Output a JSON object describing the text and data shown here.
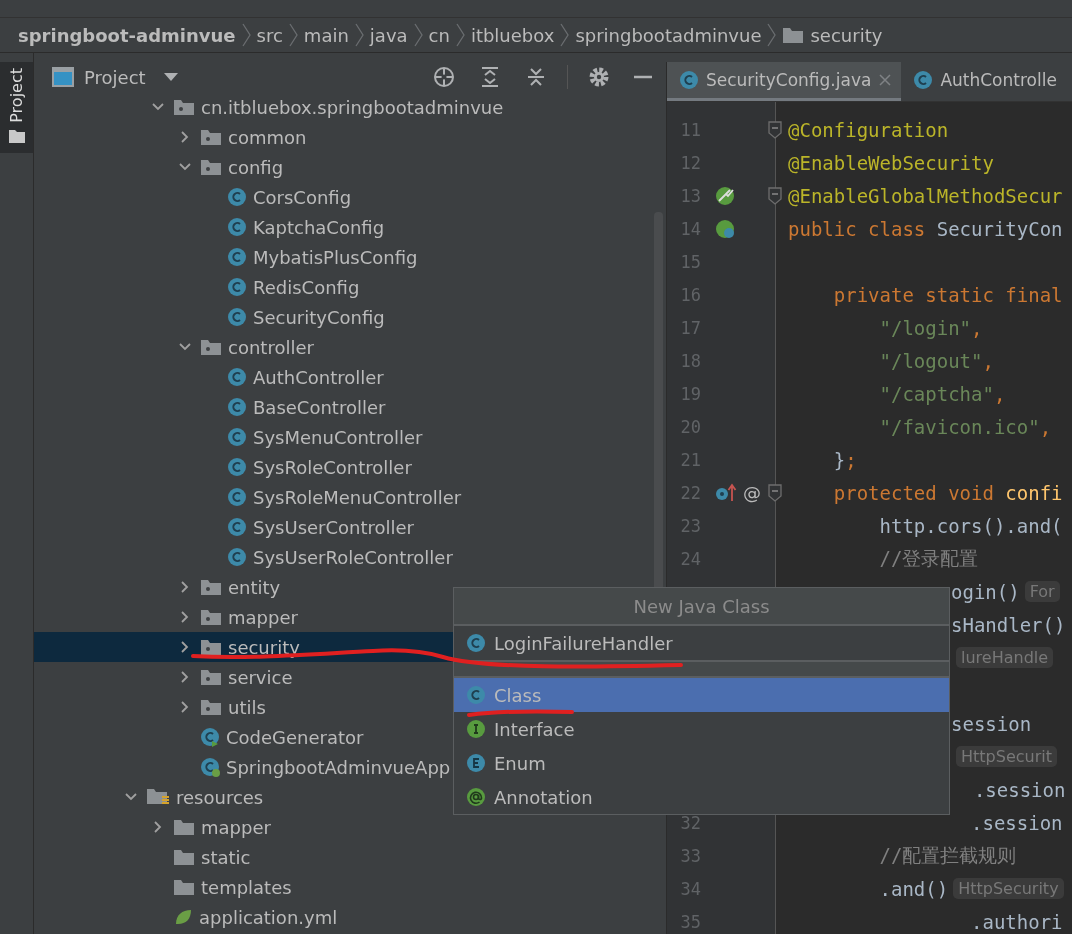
{
  "breadcrumb": [
    {
      "label": "springboot-adminvue",
      "kind": "project"
    },
    {
      "label": "src",
      "kind": "plain"
    },
    {
      "label": "main",
      "kind": "plain"
    },
    {
      "label": "java",
      "kind": "plain"
    },
    {
      "label": "cn",
      "kind": "plain"
    },
    {
      "label": "itbluebox",
      "kind": "plain"
    },
    {
      "label": "springbootadminvue",
      "kind": "plain"
    },
    {
      "label": "security",
      "kind": "folder"
    }
  ],
  "tool_strip": {
    "label": "Project",
    "selected": true
  },
  "project_panel": {
    "title": "Project",
    "tree": [
      {
        "kind": "hidden-parent",
        "children": [
          {
            "label": "cn.itbluebox.springbootadminvue",
            "kind": "package",
            "expanded": true,
            "selected": false,
            "children": [
              {
                "label": "common",
                "kind": "package",
                "expanded": false,
                "selected": false
              },
              {
                "label": "config",
                "kind": "package",
                "expanded": true,
                "selected": false,
                "children": [
                  {
                    "label": "CorsConfig",
                    "kind": "class",
                    "selected": false
                  },
                  {
                    "label": "KaptchaConfig",
                    "kind": "class",
                    "selected": false
                  },
                  {
                    "label": "MybatisPlusConfig",
                    "kind": "class",
                    "selected": false
                  },
                  {
                    "label": "RedisConfig",
                    "kind": "class",
                    "selected": false
                  },
                  {
                    "label": "SecurityConfig",
                    "kind": "class",
                    "selected": false
                  }
                ]
              },
              {
                "label": "controller",
                "kind": "package",
                "expanded": true,
                "selected": false,
                "children": [
                  {
                    "label": "AuthController",
                    "kind": "class",
                    "selected": false
                  },
                  {
                    "label": "BaseController",
                    "kind": "class",
                    "selected": false
                  },
                  {
                    "label": "SysMenuController",
                    "kind": "class",
                    "selected": false
                  },
                  {
                    "label": "SysRoleController",
                    "kind": "class",
                    "selected": false
                  },
                  {
                    "label": "SysRoleMenuController",
                    "kind": "class",
                    "selected": false
                  },
                  {
                    "label": "SysUserController",
                    "kind": "class",
                    "selected": false
                  },
                  {
                    "label": "SysUserRoleController",
                    "kind": "class",
                    "selected": false
                  }
                ]
              },
              {
                "label": "entity",
                "kind": "package",
                "expanded": false,
                "selected": false
              },
              {
                "label": "mapper",
                "kind": "package",
                "expanded": false,
                "selected": false
              },
              {
                "label": "security",
                "kind": "package",
                "expanded": false,
                "selected": true
              },
              {
                "label": "service",
                "kind": "package",
                "expanded": false,
                "selected": false
              },
              {
                "label": "utils",
                "kind": "package",
                "expanded": false,
                "selected": false
              },
              {
                "label": "CodeGenerator",
                "kind": "runnable-class",
                "selected": false
              },
              {
                "label": "SpringbootAdminvueApp",
                "kind": "spring-class",
                "selected": false
              }
            ]
          }
        ]
      },
      {
        "label": "resources",
        "kind": "resources",
        "expanded": true,
        "selected": false,
        "children": [
          {
            "label": "mapper",
            "kind": "folder",
            "expanded": false,
            "selected": false
          },
          {
            "label": "static",
            "kind": "folder",
            "selected": false
          },
          {
            "label": "templates",
            "kind": "folder",
            "selected": false
          },
          {
            "label": "application.yml",
            "kind": "yml",
            "selected": false
          }
        ]
      }
    ]
  },
  "editor": {
    "tabs": [
      {
        "label": "SecurityConfig.java",
        "selected": true
      },
      {
        "label": "AuthControlle",
        "selected": false
      }
    ],
    "lines": [
      {
        "number": "11",
        "fold": true,
        "tokens": [
          {
            "kind": "annotation",
            "text": "@Configuration"
          }
        ]
      },
      {
        "number": "12",
        "tokens": [
          {
            "kind": "annotation",
            "text": "@EnableWebSecurity"
          }
        ]
      },
      {
        "number": "13",
        "fold": true,
        "gutter": [
          {
            "kind": "bean-check"
          }
        ],
        "tokens": [
          {
            "kind": "annotation",
            "text": "@EnableGlobalMethodSecur"
          }
        ]
      },
      {
        "number": "14",
        "gutter": [
          {
            "kind": "bean-class"
          }
        ],
        "tokens": [
          {
            "kind": "keyword",
            "text": "public class "
          },
          {
            "kind": "plain",
            "text": "SecurityCon"
          }
        ]
      },
      {
        "number": "15"
      },
      {
        "number": "16",
        "tokens": [
          {
            "kind": "keyword",
            "text": "    private static final"
          }
        ]
      },
      {
        "number": "17",
        "tokens": [
          {
            "kind": "string",
            "text": "        \"/login\""
          },
          {
            "kind": "keyword",
            "text": ","
          }
        ]
      },
      {
        "number": "18",
        "tokens": [
          {
            "kind": "string",
            "text": "        \"/logout\""
          },
          {
            "kind": "keyword",
            "text": ","
          }
        ]
      },
      {
        "number": "19",
        "tokens": [
          {
            "kind": "string",
            "text": "        \"/captcha\""
          },
          {
            "kind": "keyword",
            "text": ","
          }
        ]
      },
      {
        "number": "20",
        "tokens": [
          {
            "kind": "string",
            "text": "        \"/favicon.ico\""
          },
          {
            "kind": "keyword",
            "text": ","
          }
        ]
      },
      {
        "number": "21",
        "tokens": [
          {
            "kind": "plain",
            "text": "    }"
          },
          {
            "kind": "keyword",
            "text": ";"
          }
        ]
      },
      {
        "number": "22",
        "fold": true,
        "gutter": [
          {
            "kind": "override"
          },
          {
            "kind": "text",
            "text": "@"
          }
        ],
        "tokens": [
          {
            "kind": "keyword",
            "text": "    protected void "
          },
          {
            "kind": "method",
            "text": "confi"
          }
        ]
      },
      {
        "number": "23",
        "tokens": [
          {
            "kind": "plain",
            "text": "        http.cors().and("
          }
        ]
      },
      {
        "number": "24",
        "tokens": [
          {
            "kind": "comment",
            "text": "        //登录配置"
          }
        ]
      },
      {
        "tokens": [
          {
            "kind": "plain",
            "text": "ogin()"
          },
          {
            "kind": "hint",
            "text": "For"
          }
        ]
      },
      {
        "tokens": [
          {
            "kind": "plain",
            "text": "sHandler()"
          }
        ]
      },
      {
        "tokens": [
          {
            "kind": "hint",
            "text": "lureHandle"
          }
        ]
      },
      {
        "blank_before": true,
        "tokens": [
          {
            "kind": "plain",
            "text": "session"
          }
        ]
      },
      {
        "tokens": [
          {
            "kind": "hint",
            "text": "HttpSecurit"
          }
        ]
      },
      {
        "tokens": [
          {
            "kind": "plain",
            "text": "  .session"
          }
        ]
      },
      {
        "number": "32",
        "tokens": [
          {
            "kind": "plain",
            "text": "                .session"
          }
        ]
      },
      {
        "number": "33",
        "tokens": [
          {
            "kind": "comment",
            "text": "        //配置拦截规则"
          }
        ]
      },
      {
        "number": "34",
        "tokens": [
          {
            "kind": "plain",
            "text": "        .and()"
          },
          {
            "kind": "hint",
            "text": "HttpSecurity"
          }
        ]
      },
      {
        "number": "35",
        "tokens": [
          {
            "kind": "plain",
            "text": "                .authori"
          }
        ]
      }
    ]
  },
  "popup": {
    "title": "New Java Class",
    "recent": [
      {
        "label": "LoginFailureHandler",
        "kind": "class",
        "selected": false
      }
    ],
    "items": [
      {
        "label": "Class",
        "kind": "class",
        "selected": true
      },
      {
        "label": "Interface",
        "kind": "interface",
        "selected": false
      },
      {
        "label": "Enum",
        "kind": "enum",
        "selected": false
      },
      {
        "label": "Annotation",
        "kind": "annotation",
        "selected": false
      }
    ]
  }
}
